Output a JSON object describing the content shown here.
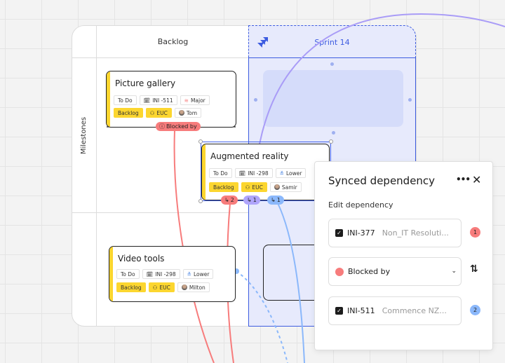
{
  "board": {
    "columns": [
      {
        "label": "Backlog"
      },
      {
        "label": "Sprint 14"
      }
    ],
    "rows": [
      {
        "label": "Milestones"
      }
    ]
  },
  "icons": {
    "sprint": "jira-logo-icon",
    "calendar": "calendar-icon",
    "priority_major": "priority-major-icon",
    "priority_lower": "priority-lower-icon",
    "team": "team-icon",
    "dependency": "dependency-icon",
    "blocked": "alert-circle-icon"
  },
  "cards": [
    {
      "title": "Picture gallery",
      "status": "To Do",
      "key": "INI -511",
      "priority": "Major",
      "tags": [
        "Backlog",
        "EUC"
      ],
      "assignee": "Tom"
    },
    {
      "title": "Augmented reality",
      "status": "To Do",
      "key": "INI -298",
      "priority": "Lower",
      "tags": [
        "Backlog",
        "EUC"
      ],
      "assignee": "Samir"
    },
    {
      "title": "Video tools",
      "status": "To Do",
      "key": "INI -298",
      "priority": "Lower",
      "tags": [
        "Backlog",
        "EUC"
      ],
      "assignee": "Milton"
    }
  ],
  "connectors": {
    "blocked_label": "Blocked by",
    "pills": [
      {
        "count": "2",
        "color": "#f77c7c"
      },
      {
        "count": "1",
        "color": "#b0a5fb"
      },
      {
        "count": "1",
        "color": "#8bb8fb"
      }
    ]
  },
  "panel": {
    "title": "Synced dependency",
    "subtitle": "Edit dependency",
    "more_label": "•••",
    "close_label": "✕",
    "items": [
      {
        "key": "INI-377",
        "description": "Non_IT Resoluti...",
        "checked": true,
        "badge": "1",
        "badge_color": "#f77c7c"
      },
      {
        "key": "INI-511",
        "description": "Commence NZ...",
        "checked": true,
        "badge": "2",
        "badge_color": "#8bb8fb"
      }
    ],
    "relation": {
      "selected": "Blocked by",
      "color": "#f77c7c"
    },
    "swap_label": "⇅"
  },
  "colors": {
    "accent": "#3d5ce0",
    "sprint_bg": "#e7eafc",
    "card_stripe": "#fcd62f",
    "red": "#f77c7c",
    "purple": "#b0a5fb",
    "blue": "#8bb8fb"
  }
}
